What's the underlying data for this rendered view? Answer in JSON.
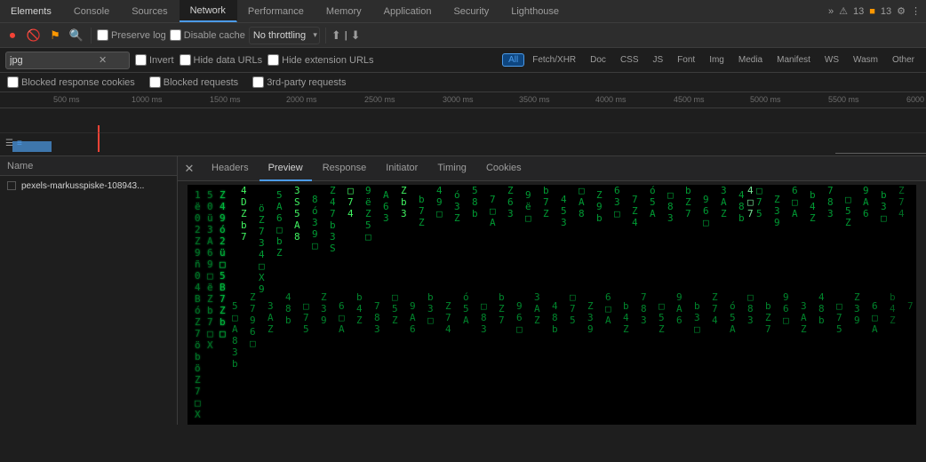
{
  "topTabs": {
    "items": [
      {
        "id": "elements",
        "label": "Elements",
        "active": false
      },
      {
        "id": "console",
        "label": "Console",
        "active": false
      },
      {
        "id": "sources",
        "label": "Sources",
        "active": false
      },
      {
        "id": "network",
        "label": "Network",
        "active": true
      },
      {
        "id": "performance",
        "label": "Performance",
        "active": false
      },
      {
        "id": "memory",
        "label": "Memory",
        "active": false
      },
      {
        "id": "application",
        "label": "Application",
        "active": false
      },
      {
        "id": "security",
        "label": "Security",
        "active": false
      },
      {
        "id": "lighthouse",
        "label": "Lighthouse",
        "active": false
      }
    ],
    "overflow": "»",
    "errorCount": "13",
    "warnCount": "13"
  },
  "toolbar": {
    "preserveLog": "Preserve log",
    "disableCache": "Disable cache",
    "throttle": "No throttling"
  },
  "filterBar": {
    "searchValue": "jpg",
    "invertLabel": "Invert",
    "hideDataURLs": "Hide data URLs",
    "hideExtensionURLs": "Hide extension URLs",
    "typeButtons": [
      {
        "id": "all",
        "label": "All",
        "active": true
      },
      {
        "id": "fetch",
        "label": "Fetch/XHR",
        "active": false
      },
      {
        "id": "doc",
        "label": "Doc",
        "active": false
      },
      {
        "id": "css",
        "label": "CSS",
        "active": false
      },
      {
        "id": "js",
        "label": "JS",
        "active": false
      },
      {
        "id": "font",
        "label": "Font",
        "active": false
      },
      {
        "id": "img",
        "label": "Img",
        "active": false
      },
      {
        "id": "media",
        "label": "Media",
        "active": false
      },
      {
        "id": "manifest",
        "label": "Manifest",
        "active": false
      },
      {
        "id": "ws",
        "label": "WS",
        "active": false
      },
      {
        "id": "wasm",
        "label": "Wasm",
        "active": false
      },
      {
        "id": "other",
        "label": "Other",
        "active": false
      }
    ]
  },
  "checkboxesRow": {
    "blockedCookies": "Blocked response cookies",
    "blockedRequests": "Blocked requests",
    "thirdParty": "3rd-party requests"
  },
  "timeline": {
    "ticks": [
      "500 ms",
      "1000 ms",
      "1500 ms",
      "2000 ms",
      "2500 ms",
      "3000 ms",
      "3500 ms",
      "4000 ms",
      "4500 ms",
      "5000 ms",
      "5500 ms",
      "6000"
    ]
  },
  "requestsHeader": {
    "nameLabel": "Name"
  },
  "requests": [
    {
      "name": "pexels-markusspiske-108943...",
      "icon": "black"
    }
  ],
  "panelTabs": {
    "items": [
      {
        "id": "headers",
        "label": "Headers",
        "active": false
      },
      {
        "id": "preview",
        "label": "Preview",
        "active": true
      },
      {
        "id": "response",
        "label": "Response",
        "active": false
      },
      {
        "id": "initiator",
        "label": "Initiator",
        "active": false
      },
      {
        "id": "timing",
        "label": "Timing",
        "active": false
      },
      {
        "id": "cookies",
        "label": "Cookies",
        "active": false
      }
    ]
  },
  "matrixColors": {
    "bg": "#000000",
    "text": "#00cc44"
  }
}
